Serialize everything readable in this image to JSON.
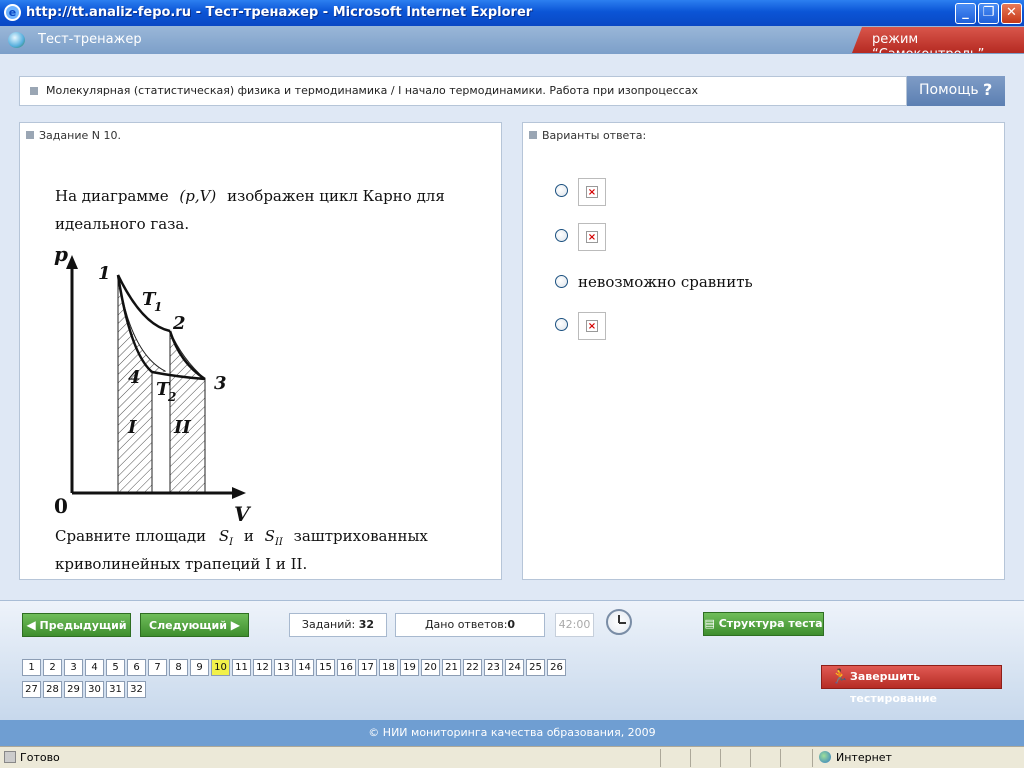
{
  "window": {
    "title": "http://tt.analiz-fepo.ru - Тест-тренажер - Microsoft Internet Explorer",
    "buttons": {
      "minimize": "_",
      "restore": "❐",
      "close": "✕"
    }
  },
  "app": {
    "title": "Тест-тренажер",
    "mode": "режим “Самоконтроль”"
  },
  "topic": {
    "text": "Молекулярная (статистическая) физика и термодинамика / I начало термодинамики. Работа при изопроцессах",
    "help_label": "Помощь",
    "help_icon": "?"
  },
  "task": {
    "header": "Задание N 10.",
    "line1_a": "На диаграмме",
    "line1_formula": "(p,V)",
    "line1_b": "изображен цикл Карно для",
    "line2": "идеального газа.",
    "diagram_labels": {
      "p": "p",
      "v": "V",
      "zero": "0",
      "n1": "1",
      "n2": "2",
      "n3": "3",
      "n4": "4",
      "t1": "T",
      "t1_sub": "1",
      "t2": "T",
      "t2_sub": "2",
      "area1": "I",
      "area2": "II"
    },
    "question_a": "Сравните площади",
    "s1": "S",
    "s1_sub": "I",
    "and": "и",
    "s2": "S",
    "s2_sub": "II",
    "question_b": "заштрихованных",
    "question_line2": "криволинейных трапеций I и II."
  },
  "answers": {
    "header": "Варианты ответа:",
    "options": [
      {
        "type": "image",
        "text": ""
      },
      {
        "type": "image",
        "text": ""
      },
      {
        "type": "text",
        "text": "невозможно сравнить"
      },
      {
        "type": "image",
        "text": ""
      }
    ],
    "broken_image_glyph": "×"
  },
  "nav": {
    "prev": "Предыдущий",
    "next": "Следующий",
    "tasks_label": "Заданий:",
    "tasks_count": "32",
    "answers_label": "Дано ответов:",
    "answers_count": "0",
    "timer": "42:00",
    "structure": "Структура теста",
    "finish": "Завершить тестирование",
    "current_page": 10,
    "pages": [
      "1",
      "2",
      "3",
      "4",
      "5",
      "6",
      "7",
      "8",
      "9",
      "10",
      "11",
      "12",
      "13",
      "14",
      "15",
      "16",
      "17",
      "18",
      "19",
      "20",
      "21",
      "22",
      "23",
      "24",
      "25",
      "26",
      "27",
      "28",
      "29",
      "30",
      "31",
      "32"
    ]
  },
  "footer": {
    "text": "© НИИ мониторинга качества образования, 2009"
  },
  "status": {
    "left": "Готово",
    "zone": "Интернет"
  },
  "colors": {
    "accent_blue": "#0a48c4",
    "green": "#3e8e2e",
    "red": "#b62c25",
    "active_page": "#f1f14a"
  }
}
